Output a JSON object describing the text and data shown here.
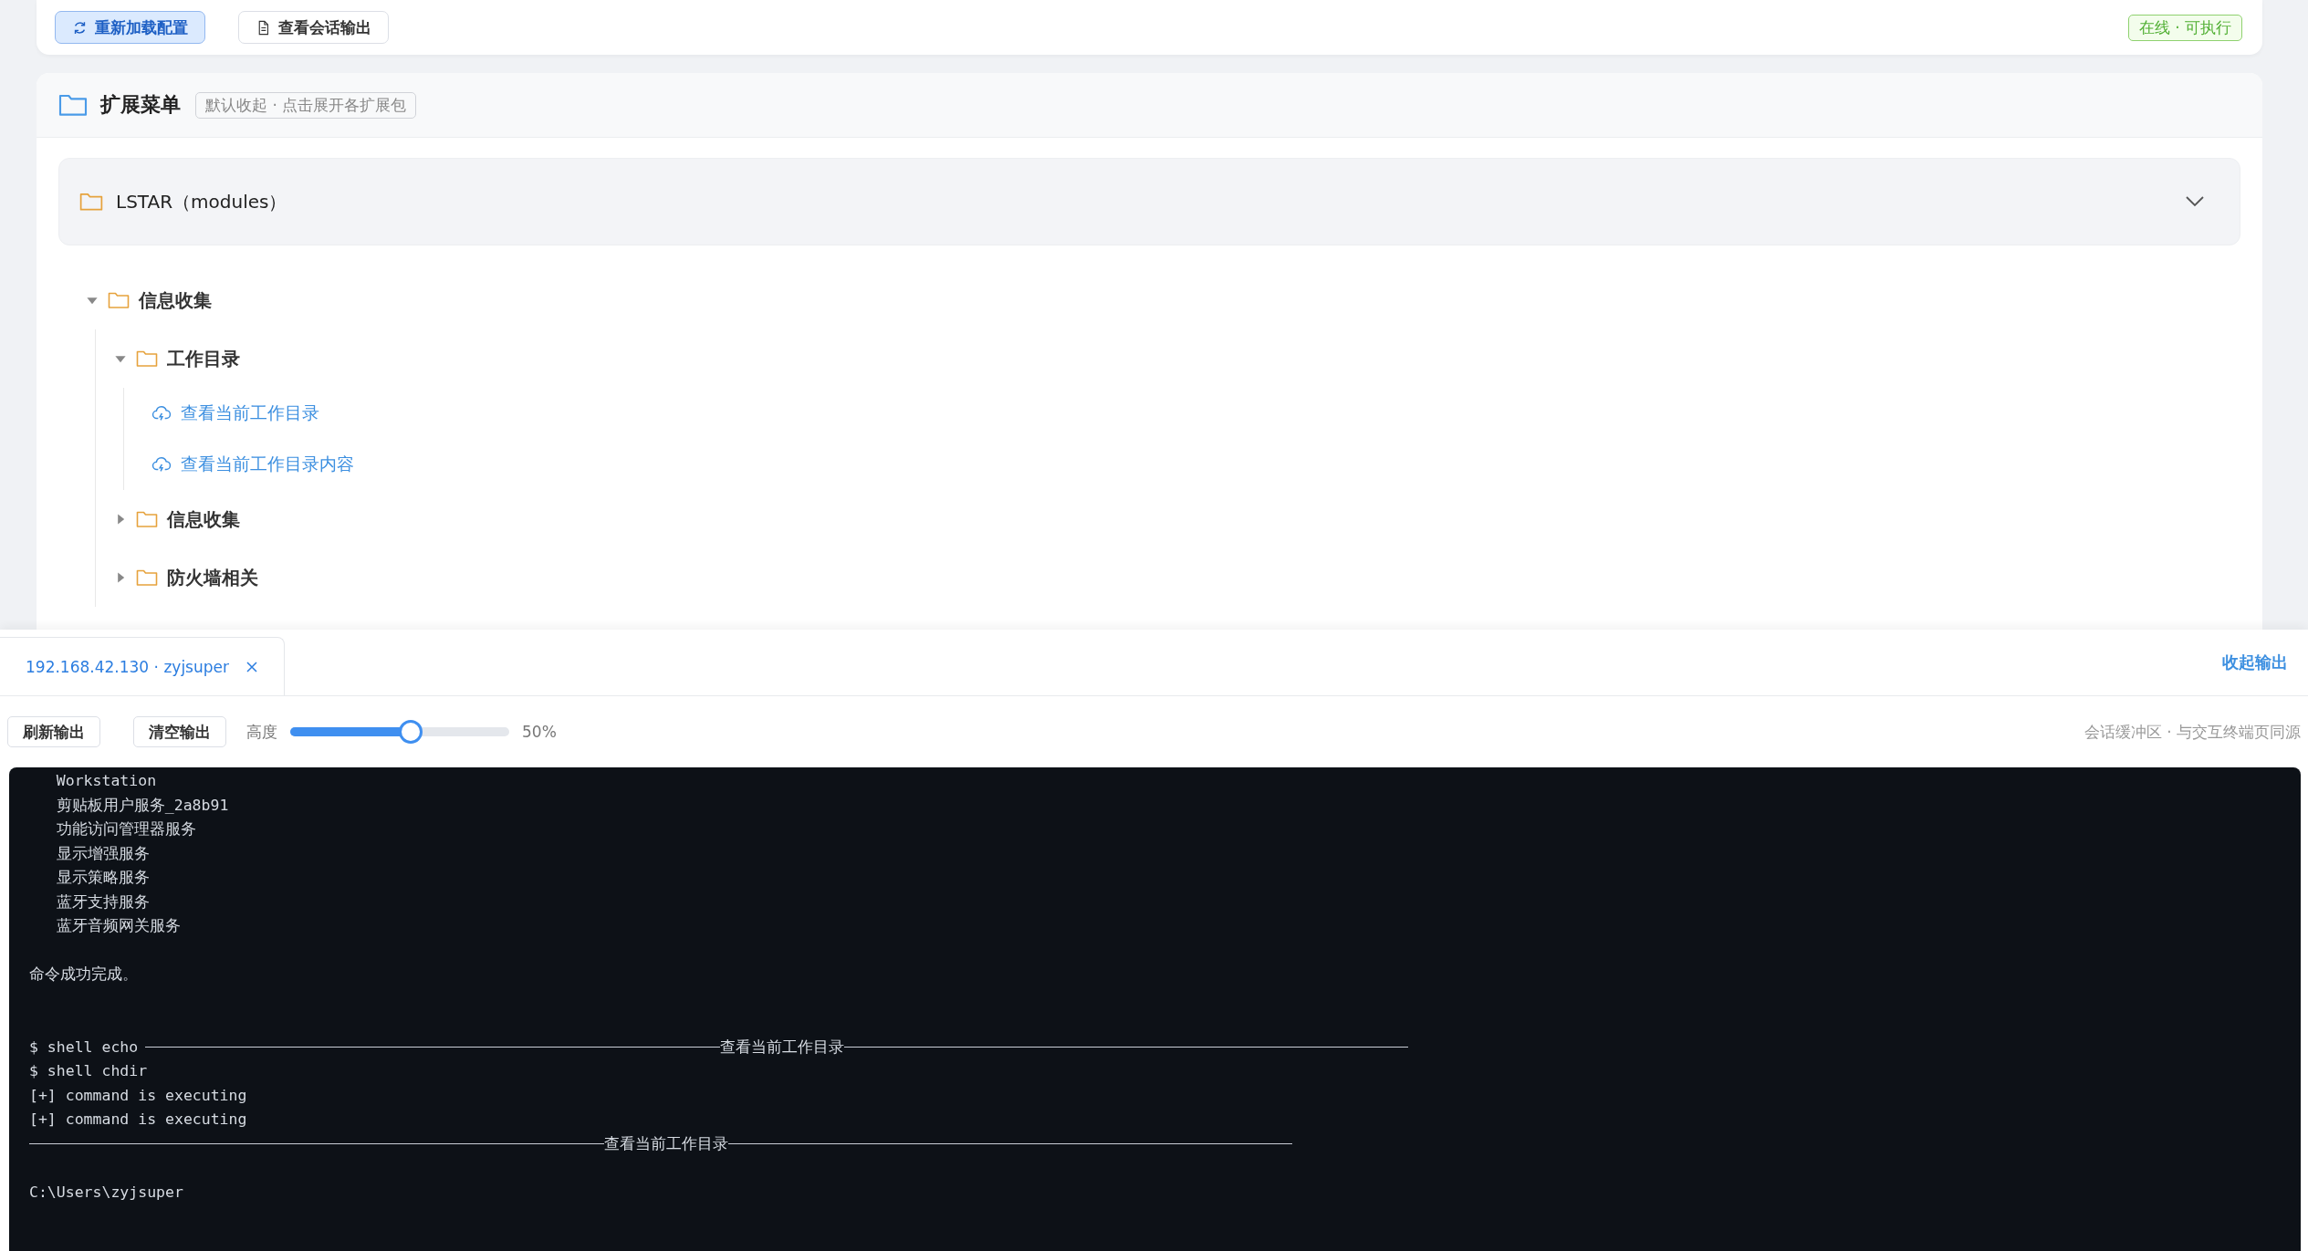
{
  "toolbar": {
    "buttons": [
      {
        "label": "重新加载配置",
        "kind": "primary"
      },
      {
        "label": "查看会话输出",
        "kind": "default"
      }
    ],
    "status": "在线 · 可执行"
  },
  "extension_menu": {
    "title": "扩展菜单",
    "hint": "默认收起 · 点击展开各扩展包",
    "package": {
      "title": "LSTAR（modules）"
    },
    "tree": [
      {
        "kind": "folder",
        "label": "信息收集",
        "expanded": true,
        "children": [
          {
            "kind": "folder",
            "label": "工作目录",
            "expanded": true,
            "children": [
              {
                "kind": "command",
                "label": "查看当前工作目录"
              },
              {
                "kind": "command",
                "label": "查看当前工作目录内容"
              }
            ]
          },
          {
            "kind": "folder",
            "label": "信息收集",
            "expanded": false
          },
          {
            "kind": "folder",
            "label": "防火墙相关",
            "expanded": false
          }
        ]
      }
    ]
  },
  "output_panel": {
    "tabs": [
      {
        "label": "192.168.42.130 · zyjsuper",
        "selected": true
      }
    ],
    "collapse_link": "收起输出",
    "buttons": [
      "刷新输出",
      "清空输出"
    ],
    "height_slider": {
      "label": "高度",
      "level": 0.55,
      "reading": "50%"
    },
    "note": "会话缓冲区 · 与交互终端页同源",
    "terminal": [
      {
        "kind": "text",
        "text": "   Workstation"
      },
      {
        "kind": "text",
        "text": "   剪贴板用户服务_2a8b91"
      },
      {
        "kind": "text",
        "text": "   功能访问管理器服务"
      },
      {
        "kind": "text",
        "text": "   显示增强服务"
      },
      {
        "kind": "text",
        "text": "   显示策略服务"
      },
      {
        "kind": "text",
        "text": "   蓝牙支持服务"
      },
      {
        "kind": "text",
        "text": "   蓝牙音频网关服务"
      },
      {
        "kind": "blank"
      },
      {
        "kind": "text",
        "text": "命令成功完成。"
      },
      {
        "kind": "blank"
      },
      {
        "kind": "blank"
      },
      {
        "kind": "rule",
        "prefix": "$ shell echo",
        "label": "查看当前工作目录"
      },
      {
        "kind": "text",
        "text": "$ shell chdir"
      },
      {
        "kind": "text",
        "text": "[+] command is executing"
      },
      {
        "kind": "text",
        "text": "[+] command is executing"
      },
      {
        "kind": "rule",
        "label": "查看当前工作目录"
      },
      {
        "kind": "blank"
      },
      {
        "kind": "text",
        "text": "C:\\Users\\zyjsuper"
      }
    ]
  }
}
